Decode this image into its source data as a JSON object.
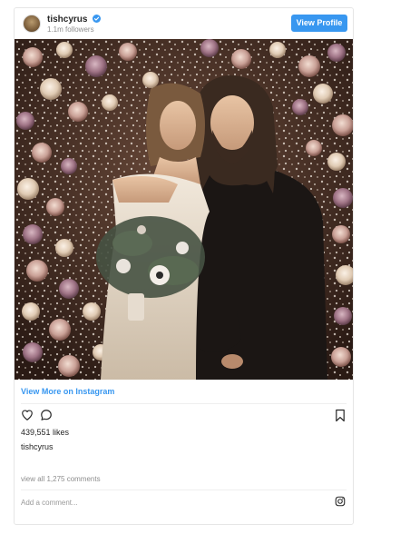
{
  "header": {
    "username": "tishcyrus",
    "followers": "1.1m followers",
    "view_profile_label": "View Profile",
    "verified_color": "#3897f0"
  },
  "post": {
    "view_more_label": "View More on Instagram",
    "likes": "439,551 likes",
    "caption_user": "tishcyrus",
    "caption_text": "⁣",
    "view_comments": "view all 1,275 comments"
  },
  "comment_box": {
    "placeholder": "Add a comment..."
  },
  "icons": {
    "avatar": "profile-avatar",
    "verified": "verified-badge-icon",
    "like": "heart-icon",
    "comment": "comment-bubble-icon",
    "save": "bookmark-icon",
    "brand": "instagram-icon"
  },
  "colors": {
    "accent": "#3897f0",
    "text": "#262626",
    "muted": "#8e8e8e"
  }
}
